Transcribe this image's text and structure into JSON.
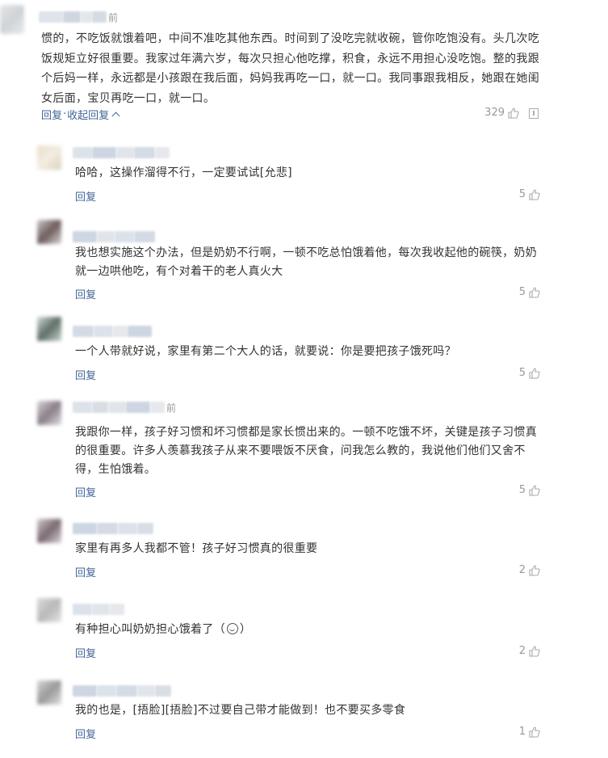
{
  "top_comment": {
    "time_tail": "前",
    "text": "惯的，不吃饭就饿着吧，中间不准吃其他东西。时间到了没吃完就收碗，管你吃饱没有。头几次吃饭规矩立好很重要。我家过年满六岁，每次只担心他吃撑，积食，永远不用担心没吃饱。整的我跟个后妈一样，永远都是小孩跟在我后面，妈妈我再吃一口，就一口。我同事跟我相反，她跟在她闺女后面，宝贝再吃一口，就一口。",
    "reply_label": "回复",
    "separator": "·",
    "collapse_label": "收起回复",
    "likes": "329"
  },
  "replies": [
    {
      "time_tail": "",
      "text": "哈哈，这操作溜得不行，一定要试试[允悲]",
      "reply_label": "回复",
      "likes": "5"
    },
    {
      "time_tail": "",
      "text": "我也想实施这个办法，但是奶奶不行啊，一顿不吃总怕饿着他，每次我收起他的碗筷，奶奶就一边哄他吃，有个对着干的老人真火大",
      "reply_label": "回复",
      "likes": "5"
    },
    {
      "time_tail": "",
      "text": "一个人带就好说，家里有第二个大人的话，就要说：你是要把孩子饿死吗？",
      "reply_label": "回复",
      "likes": "5"
    },
    {
      "time_tail": "前",
      "text": "我跟你一样，孩子好习惯和坏习惯都是家长惯出来的。一顿不吃饿不坏，关键是孩子习惯真的很重要。许多人羡慕我孩子从来不要喂饭不厌食，问我怎么教的，我说他们他们又舍不得，生怕饿着。",
      "reply_label": "回复",
      "likes": "5"
    },
    {
      "time_tail": "",
      "text": "家里有再多人我都不管！孩子好习惯真的很重要",
      "reply_label": "回复",
      "likes": "2"
    },
    {
      "time_tail": "",
      "text_before": "有种担心叫奶奶担心饿着了（",
      "text_after": "）",
      "reply_label": "回复",
      "likes": "2"
    },
    {
      "time_tail": "",
      "text": "我的也是，[捂脸][捂脸]不过要自己带才能做到！也不要买多零食",
      "reply_label": "回复",
      "likes": "1"
    }
  ],
  "colors": {
    "link": "#406599",
    "text": "#333333",
    "muted": "#999999"
  }
}
